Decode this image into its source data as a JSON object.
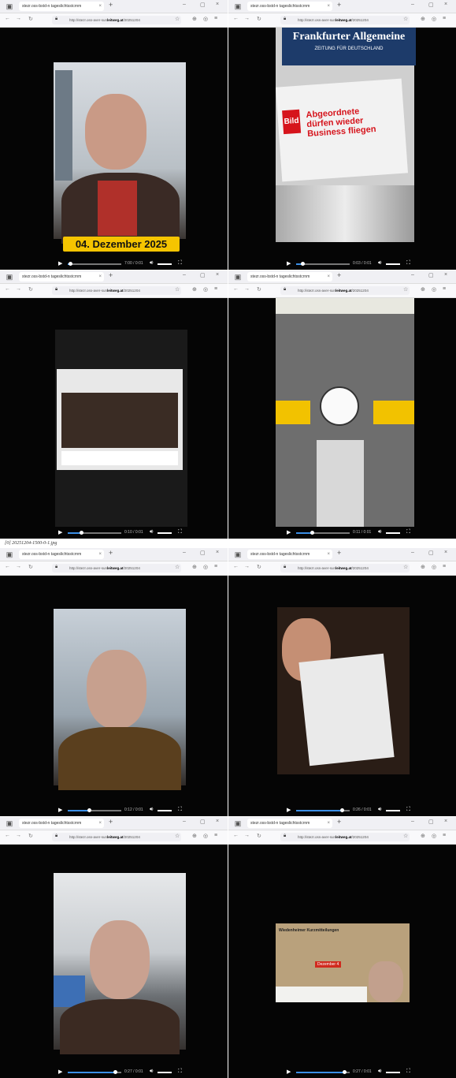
{
  "caption": "[0] 20251204-1500-0-1.jpg",
  "browser": {
    "window_controls": {
      "min": "–",
      "max": "▢",
      "close": "×"
    },
    "new_tab": "+"
  },
  "panels": [
    {
      "tab": "stezr.oss-bstd-n tageslichtsstcrnm",
      "url": "http://stezr.oss-aver-sun",
      "domain": "leitweg.at",
      "url_tail": "/20251204",
      "time": "7:00 / 0:01",
      "progress": 0.05,
      "date_badge": "04. Dezember 2025"
    },
    {
      "tab": "stezr.oss-bstd-n tageslichtsstcrnm",
      "url": "http://stezr.oss-aver-sun",
      "domain": "leitweg.at",
      "url_tail": "/20251204",
      "time": "0:03 / 0:01",
      "progress": 0.12,
      "sign_title": "Frankfurter Allgemeine",
      "sign_sub": "ZEITUNG FÜR DEUTSCHLAND",
      "headline": "Abgeordnete dürfen wieder Business fliegen",
      "tabloid": "Bild"
    },
    {
      "tab": "stezr.oss-bstd-n tageslichtsstcrnm",
      "url": "http://stezr.oss-aver-sun",
      "domain": "leitweg.at",
      "url_tail": "/20251204",
      "time": "0:10 / 0:01",
      "progress": 0.25
    },
    {
      "tab": "stezr.oss-bstd-n tageslichtsstcrnm",
      "url": "http://stezr.oss-aver-sun",
      "domain": "leitweg.at",
      "url_tail": "/20251204",
      "time": "0:11 / 0:01",
      "progress": 0.3
    },
    {
      "tab": "stezr.oss-bstd-n tageslichtsstcrnm",
      "url": "http://stezr.oss-aver-sun",
      "domain": "leitweg.at",
      "url_tail": "/20251204",
      "time": "0:12 / 0:01",
      "progress": 0.4
    },
    {
      "tab": "stezr.oss-bstd-n tageslichtsstcrnm",
      "url": "http://stezr.oss-aver-sun",
      "domain": "leitweg.at",
      "url_tail": "/20251204",
      "time": "0:26 / 0:01",
      "progress": 0.85
    },
    {
      "tab": "stezr.oss-bstd-n tageslichtsstcrnm",
      "url": "http://stezr.oss-aver-sun",
      "domain": "leitweg.at",
      "url_tail": "/20251204",
      "time": "0:27 / 0:01",
      "progress": 0.88
    },
    {
      "tab": "stezr.oss-bstd-n tageslichtsstcrnm",
      "url": "http://stezr.oss-aver-sun",
      "domain": "leitweg.at",
      "url_tail": "/20251204",
      "time": "0:27 / 0:01",
      "progress": 0.9,
      "thumb_title": "Wiedenheimer Kurzmitteilungen",
      "thumb_date": "Dezember 4"
    }
  ],
  "colors": {
    "accent": "#3b8fe6",
    "badge": "#f5c400"
  }
}
